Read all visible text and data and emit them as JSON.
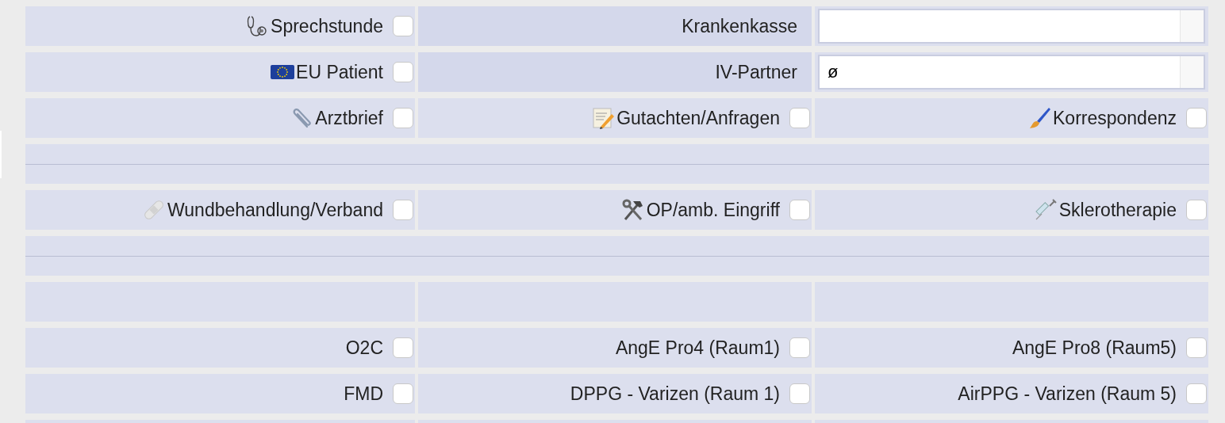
{
  "rows": [
    {
      "kind": "cells",
      "cells": [
        {
          "kind": "checkbox",
          "label": "Sprechstunde",
          "checked": false
        },
        {
          "kind": "label",
          "label": "Krankenkasse"
        },
        {
          "kind": "field"
        }
      ]
    },
    {
      "kind": "cells",
      "cells": [
        {
          "kind": "checkbox",
          "label": "EU Patient",
          "checked": false
        },
        {
          "kind": "label",
          "label": "IV-Partner"
        },
        {
          "kind": "field",
          "value": "ø"
        }
      ]
    },
    {
      "kind": "cells",
      "cells": [
        {
          "kind": "checkbox",
          "label": "Arztbrief",
          "checked": false
        },
        {
          "kind": "checkbox",
          "label": "Gutachten/Anfragen",
          "checked": false
        },
        {
          "kind": "checkbox",
          "label": "Korrespondenz",
          "checked": false
        }
      ]
    },
    {
      "kind": "separator"
    },
    {
      "kind": "cells",
      "cells": [
        {
          "kind": "checkbox",
          "label": "Wundbehandlung/Verband",
          "checked": false
        },
        {
          "kind": "checkbox",
          "label": "OP/amb. Eingriff",
          "checked": false
        },
        {
          "kind": "checkbox",
          "label": "Sklerotherapie",
          "checked": false
        }
      ]
    },
    {
      "kind": "separator"
    },
    {
      "kind": "cells",
      "cells": [
        {
          "kind": "empty"
        },
        {
          "kind": "empty"
        },
        {
          "kind": "empty"
        }
      ]
    },
    {
      "kind": "cells",
      "cells": [
        {
          "kind": "checkbox",
          "label": "O2C",
          "checked": false
        },
        {
          "kind": "checkbox",
          "label": "AngE Pro4 (Raum1)",
          "checked": false
        },
        {
          "kind": "checkbox",
          "label": "AngE Pro8 (Raum5)",
          "checked": false
        }
      ]
    },
    {
      "kind": "cells",
      "cells": [
        {
          "kind": "checkbox",
          "label": "FMD",
          "checked": false
        },
        {
          "kind": "checkbox",
          "label": "DPPG - Varizen (Raum 1)",
          "checked": false
        },
        {
          "kind": "checkbox",
          "label": "AirPPG - Varizen (Raum 5)",
          "checked": false
        }
      ]
    },
    {
      "kind": "cells",
      "cells": [
        {
          "kind": "empty"
        },
        {
          "kind": "empty"
        },
        {
          "kind": "empty"
        }
      ]
    }
  ]
}
